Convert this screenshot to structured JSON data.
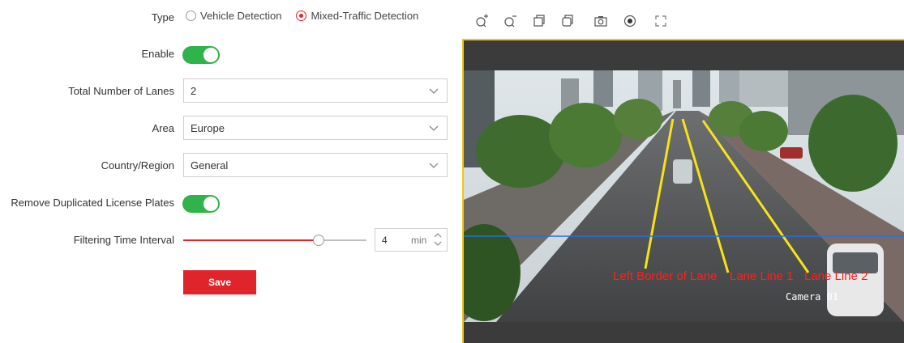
{
  "form": {
    "type": {
      "label": "Type",
      "options": [
        "Vehicle Detection",
        "Mixed-Traffic Detection"
      ],
      "selected": "Mixed-Traffic Detection"
    },
    "enable": {
      "label": "Enable",
      "on": true
    },
    "lanes": {
      "label": "Total Number of Lanes",
      "value": "2"
    },
    "area": {
      "label": "Area",
      "value": "Europe"
    },
    "country": {
      "label": "Country/Region",
      "value": "General"
    },
    "dup_plates": {
      "label": "Remove Duplicated License Plates",
      "on": true
    },
    "filter": {
      "label": "Filtering Time Interval",
      "value": "4",
      "unit": "min",
      "slider_fraction": 0.74
    },
    "save_label": "Save"
  },
  "toolbar": {
    "icons": [
      "zoom-in-icon",
      "zoom-out-icon",
      "copy-icon",
      "copy-alt-icon",
      "camera-icon",
      "record-icon",
      "fullscreen-icon"
    ]
  },
  "video": {
    "lane_labels": [
      "Left Border of Lane",
      "Lane Line 1",
      "Lane Line 2"
    ],
    "camera_label": "Camera 01"
  },
  "colors": {
    "accent": "#e0242c",
    "toggle_on": "#2fb34a",
    "lane_line": "#f5e31a",
    "detection_line": "#2b6de0",
    "frame_border": "#f0c419"
  }
}
